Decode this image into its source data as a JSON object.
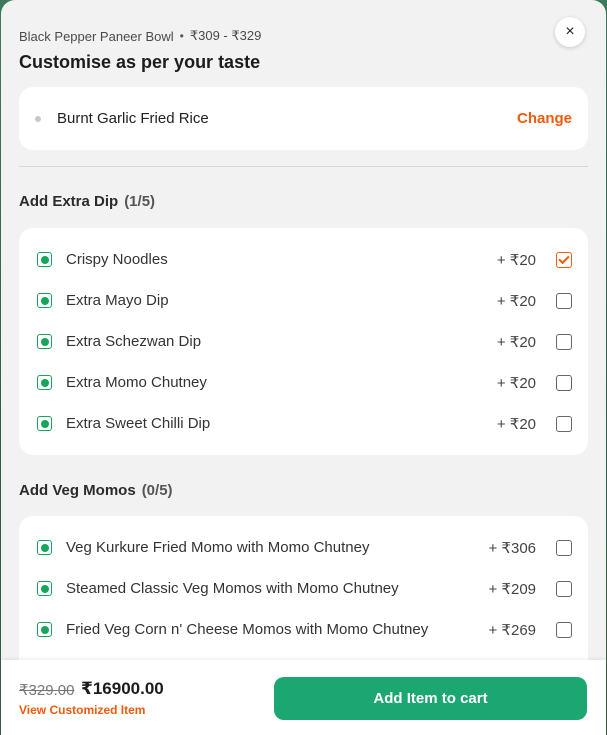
{
  "header": {
    "item_name": "Black Pepper Paneer Bowl",
    "separator": "•",
    "price_range": "₹309 - ₹329",
    "title": "Customise as per your taste",
    "close_icon": "×"
  },
  "selected": {
    "label": "Burnt Garlic Fried Rice",
    "change_label": "Change"
  },
  "sections": [
    {
      "title": "Add Extra Dip",
      "count": "(1/5)",
      "items": [
        {
          "label": "Crispy Noodles",
          "price": "+ ₹20",
          "checked": true
        },
        {
          "label": "Extra Mayo Dip",
          "price": "+ ₹20",
          "checked": false
        },
        {
          "label": "Extra Schezwan Dip",
          "price": "+ ₹20",
          "checked": false
        },
        {
          "label": "Extra Momo Chutney",
          "price": "+ ₹20",
          "checked": false
        },
        {
          "label": "Extra Sweet Chilli Dip",
          "price": "+ ₹20",
          "checked": false
        }
      ]
    },
    {
      "title": "Add Veg Momos",
      "count": "(0/5)",
      "items": [
        {
          "label": "Veg Kurkure Fried Momo with Momo Chutney",
          "price": "+ ₹306",
          "checked": false
        },
        {
          "label": "Steamed Classic Veg Momos with Momo Chutney",
          "price": "+ ₹209",
          "checked": false
        },
        {
          "label": "Fried Veg Corn n' Cheese Momos with Momo Chutney",
          "price": "+ ₹269",
          "checked": false
        }
      ]
    }
  ],
  "footer": {
    "old_price": "₹329.00",
    "new_price": "₹16900.00",
    "view_label": "View Customized Item",
    "add_label": "Add Item to cart"
  },
  "colors": {
    "accent_orange": "#f15a0a",
    "veg_green": "#1aa35a",
    "button_green": "#1ba672"
  }
}
